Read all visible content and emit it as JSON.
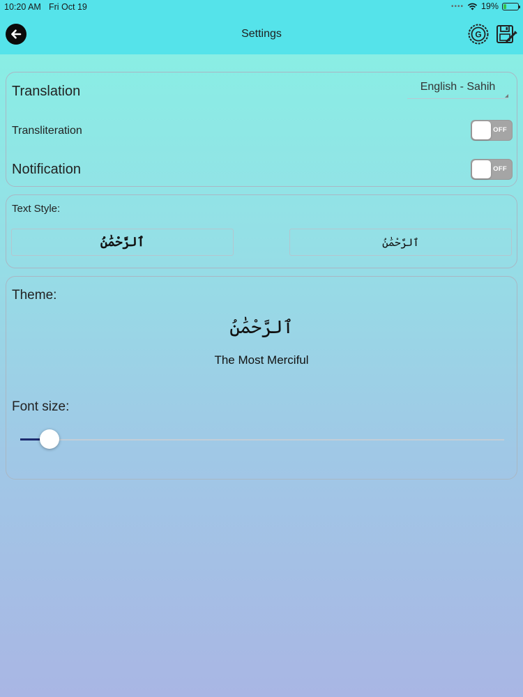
{
  "status_bar": {
    "time": "10:20 AM",
    "date": "Fri Oct 19",
    "signal_icon": "wifi-icon",
    "battery": "19%",
    "battery_level": 0.19
  },
  "header": {
    "title": "Settings",
    "back_icon": "back-arrow-icon",
    "right_icons": [
      "restore-settings-icon",
      "save-settings-icon"
    ]
  },
  "general": {
    "translation_label": "Translation",
    "translation_value": "English - Sahih",
    "transliteration_label": "Transliteration",
    "transliteration_state": "OFF",
    "notification_label": "Notification",
    "notification_state": "OFF"
  },
  "text_style": {
    "label": "Text Style:",
    "option_1": "ٱلرَّحْمَٰنُ",
    "option_2": "ٱلرَّحْمَٰنُ"
  },
  "theme": {
    "label": "Theme:",
    "arabic_preview": "ٱلرَّحْمَٰنُ",
    "translation_preview": "The Most Merciful",
    "font_size_label": "Font size:",
    "font_size_level": 0.06
  },
  "colors": {
    "header": "#55e3ea",
    "slider_fill": "#1d2a6e"
  }
}
